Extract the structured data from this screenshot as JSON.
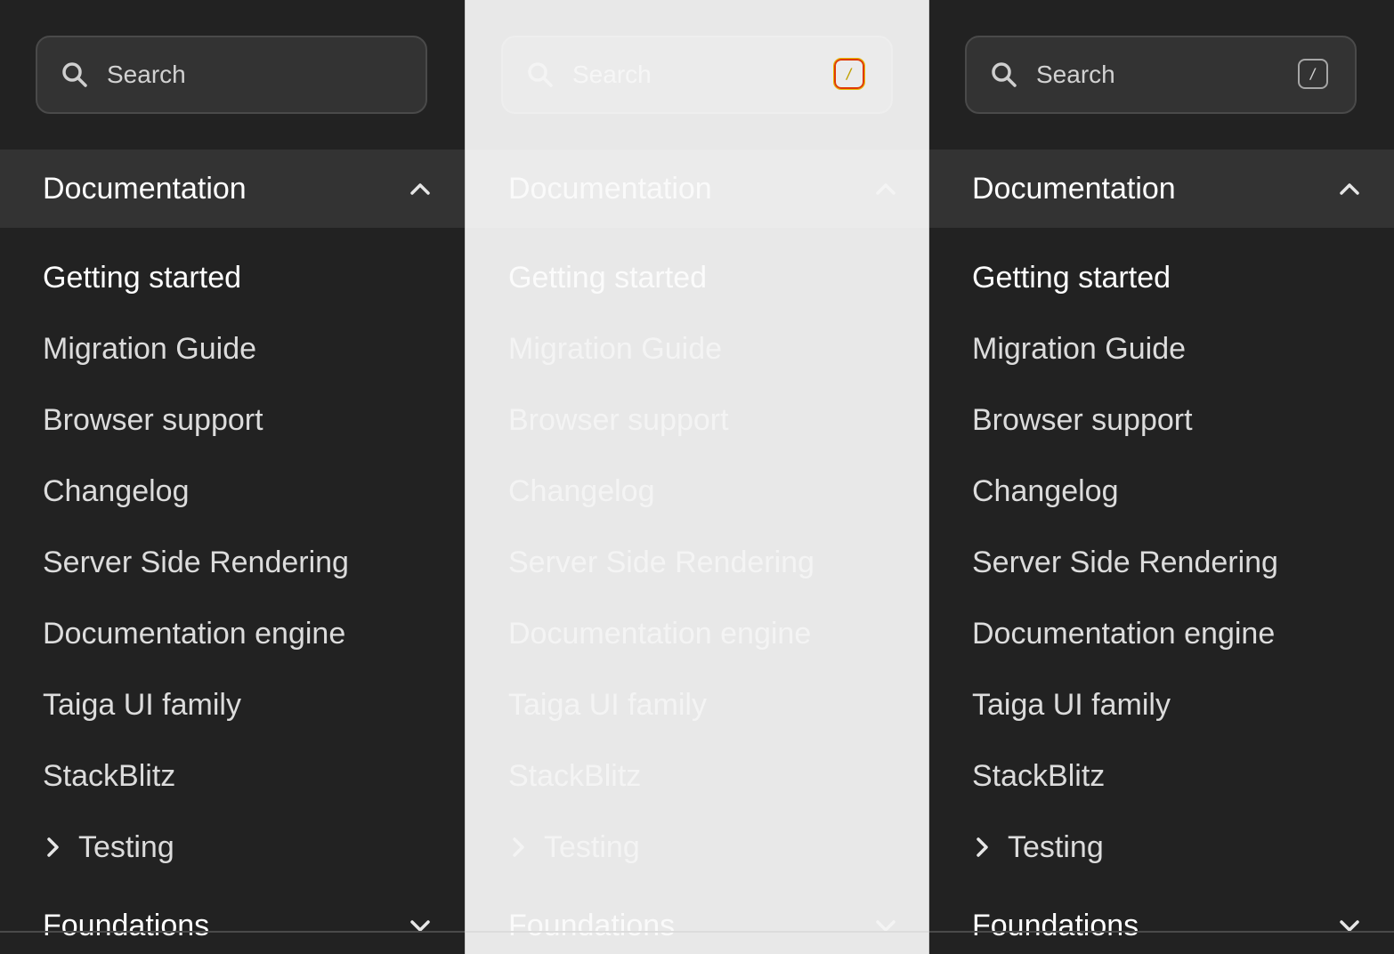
{
  "panels": [
    {
      "theme": "dark",
      "search": {
        "placeholder": "Search",
        "shortcut": ""
      },
      "section": {
        "title": "Documentation",
        "expanded": true
      },
      "items": [
        "Getting started",
        "Migration Guide",
        "Browser support",
        "Changelog",
        "Server Side Rendering",
        "Documentation engine",
        "Taiga UI family",
        "StackBlitz"
      ],
      "testing": "Testing",
      "section2": {
        "title": "Foundations",
        "expanded": false
      }
    },
    {
      "theme": "light",
      "search": {
        "placeholder": "Search",
        "shortcut": "/"
      },
      "section": {
        "title": "Documentation",
        "expanded": true
      },
      "items": [
        "Getting started",
        "Migration Guide",
        "Browser support",
        "Changelog",
        "Server Side Rendering",
        "Documentation engine",
        "Taiga UI family",
        "StackBlitz"
      ],
      "testing": "Testing",
      "section2": {
        "title": "Foundations",
        "expanded": false
      }
    },
    {
      "theme": "dark",
      "search": {
        "placeholder": "Search",
        "shortcut": "/"
      },
      "section": {
        "title": "Documentation",
        "expanded": true
      },
      "items": [
        "Getting started",
        "Migration Guide",
        "Browser support",
        "Changelog",
        "Server Side Rendering",
        "Documentation engine",
        "Taiga UI family",
        "StackBlitz"
      ],
      "testing": "Testing",
      "section2": {
        "title": "Foundations",
        "expanded": false
      }
    }
  ],
  "icons": {
    "search": "search-icon",
    "collapse": "chevron-up-icon",
    "expand": "chevron-down-icon",
    "submenu": "chevron-right-icon"
  },
  "colors": {
    "dark_bg": "#222222",
    "dark_header_bg": "#333333",
    "light_bg": "#e8e8e8"
  }
}
